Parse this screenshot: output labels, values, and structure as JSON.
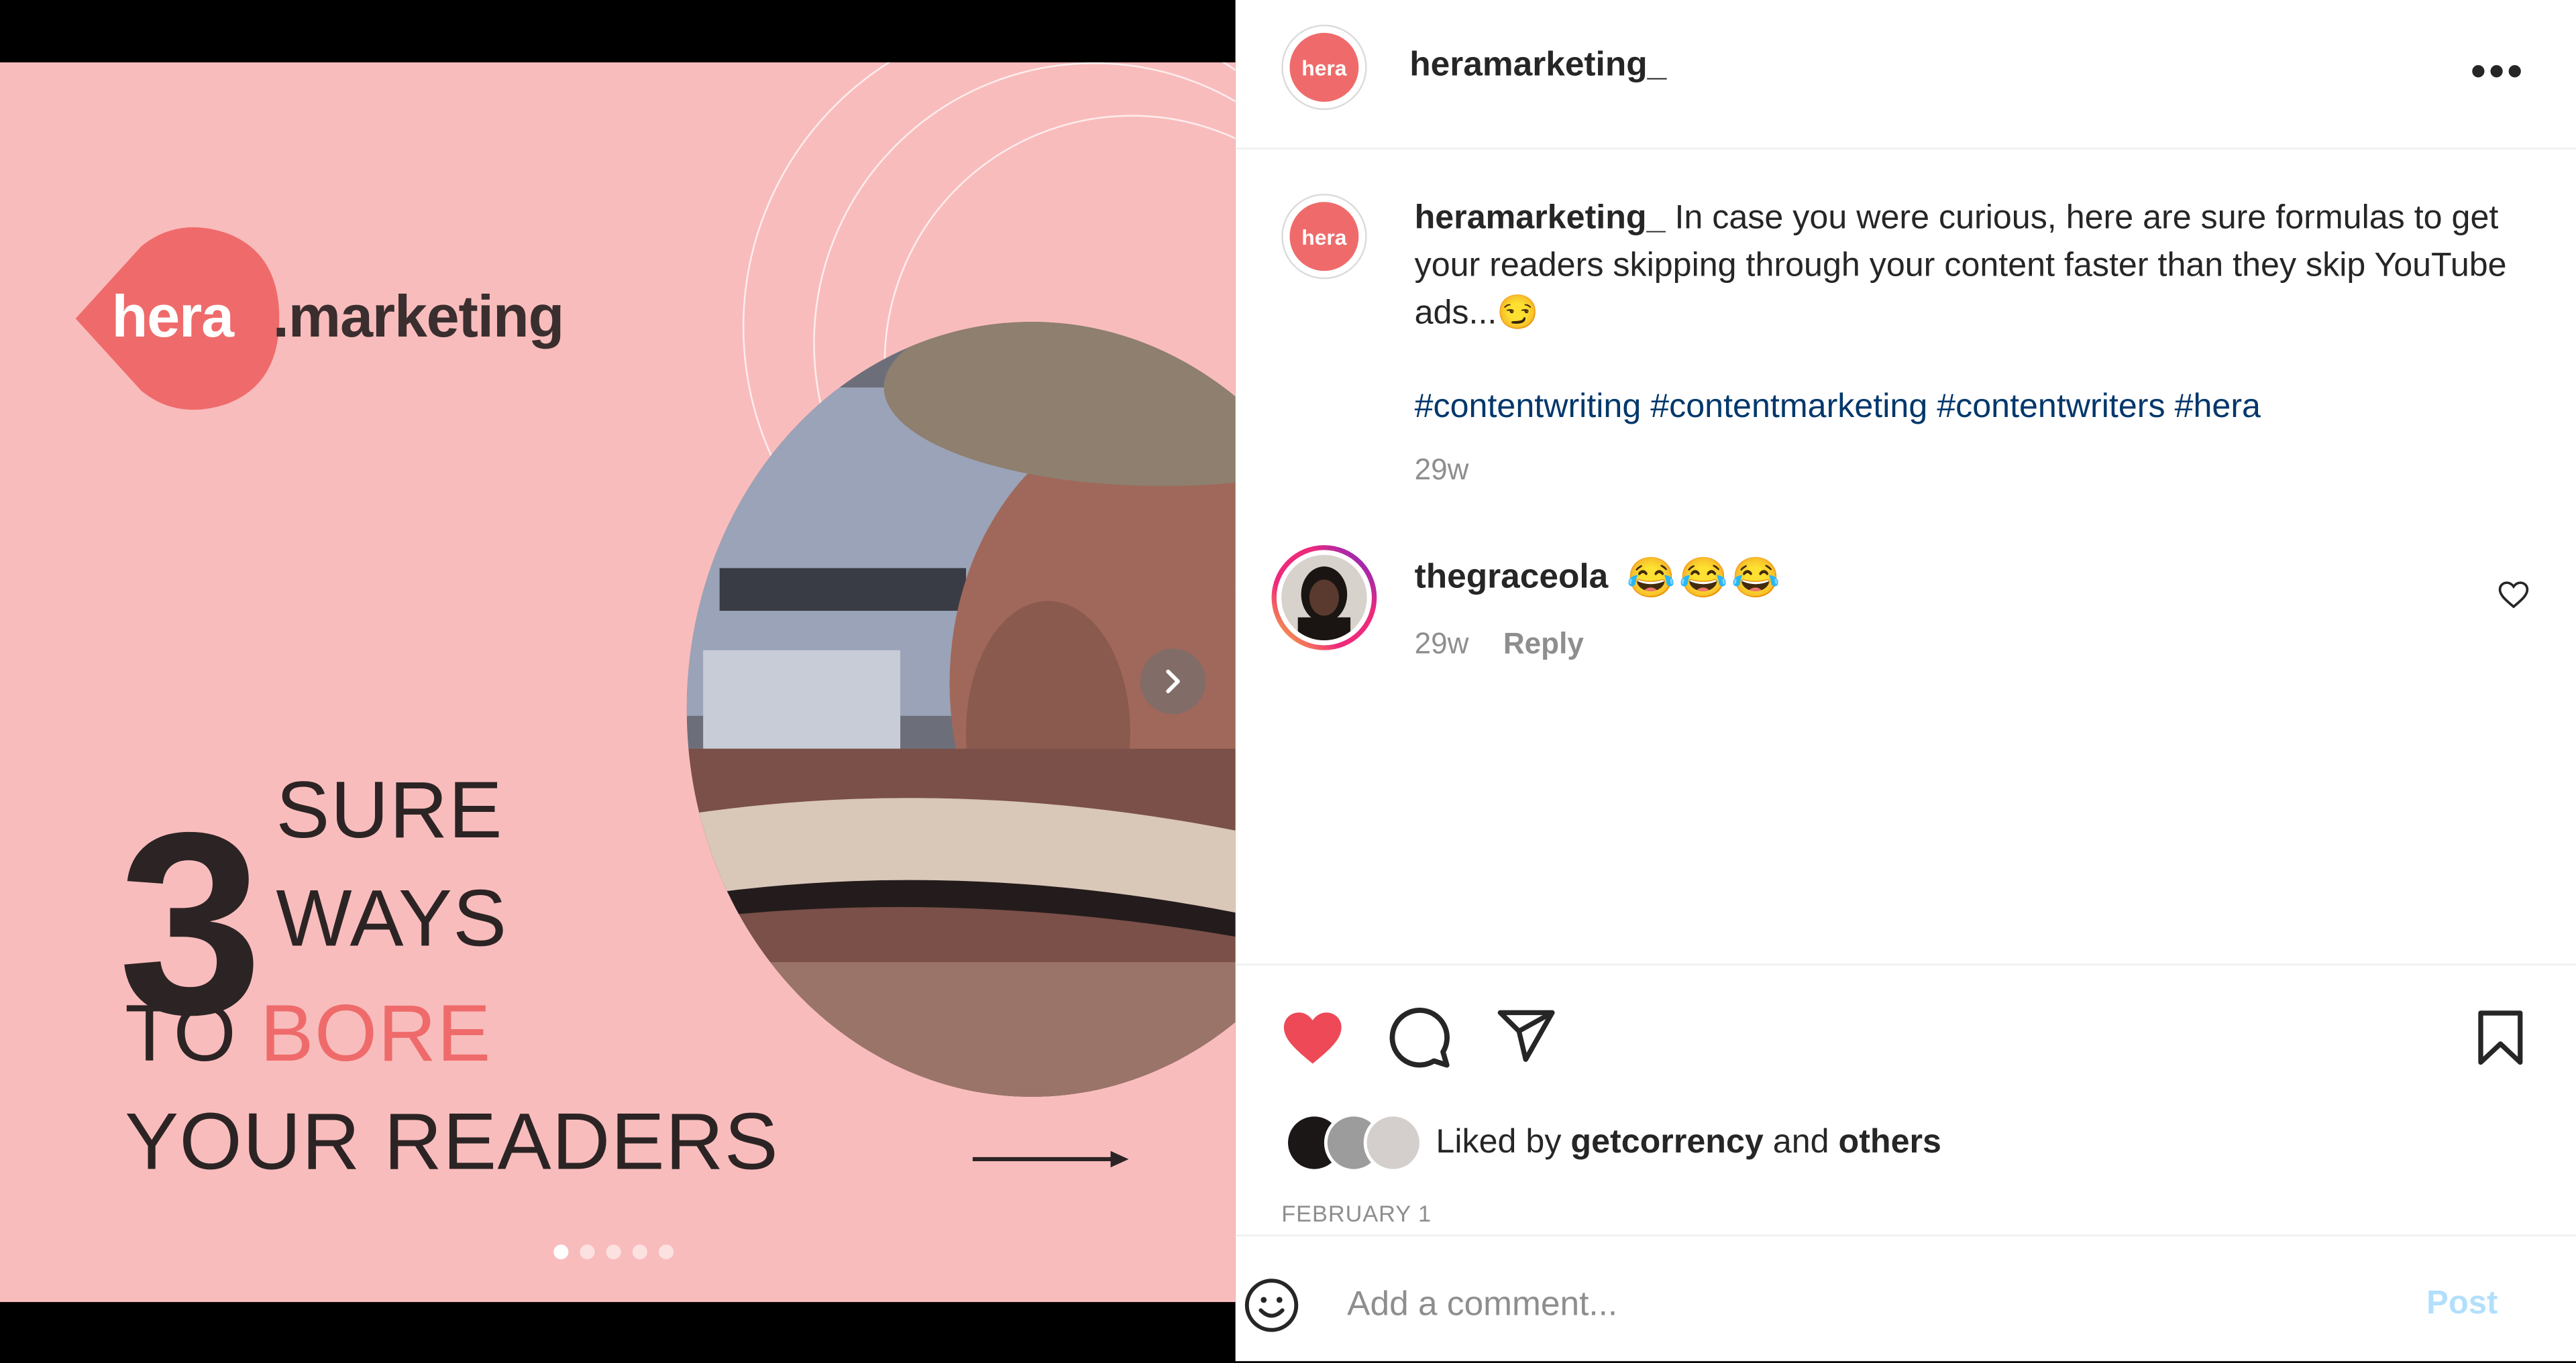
{
  "post": {
    "username": "heramarketing_",
    "avatar_label": "hera",
    "more_icon": "more-horizontal-icon",
    "caption": {
      "username": "heramarketing_",
      "text": "In case you were curious, here are sure formulas to get your readers skipping through your content faster than they skip YouTube ads...😏",
      "hashtags": "#contentwriting #contentmarketing #contentwriters #hera",
      "age": "29w"
    },
    "comments": [
      {
        "username": "thegraceola",
        "text": "😂😂😂",
        "age": "29w",
        "reply_label": "Reply"
      }
    ],
    "likes": {
      "prefix": "Liked by",
      "user": "getcorrency",
      "conj": "and",
      "others": "others"
    },
    "date": "FEBRUARY 1",
    "comment_placeholder": "Add a comment...",
    "post_label": "Post",
    "liked": true
  },
  "slide": {
    "logo_main": "hera",
    "logo_suffix": ".marketing",
    "number": "3",
    "line1": "SURE",
    "line2": "WAYS",
    "line3_a": "TO ",
    "line3_b": "BORE",
    "line4": "YOUR READERS",
    "dots_total": 5,
    "dots_active": 1
  },
  "colors": {
    "slide_bg": "#f9bcbc",
    "brand_red": "#ef6b6b",
    "like_red": "#ed4956",
    "hashtag_blue": "#00376b",
    "post_disabled": "#b2dffc"
  }
}
